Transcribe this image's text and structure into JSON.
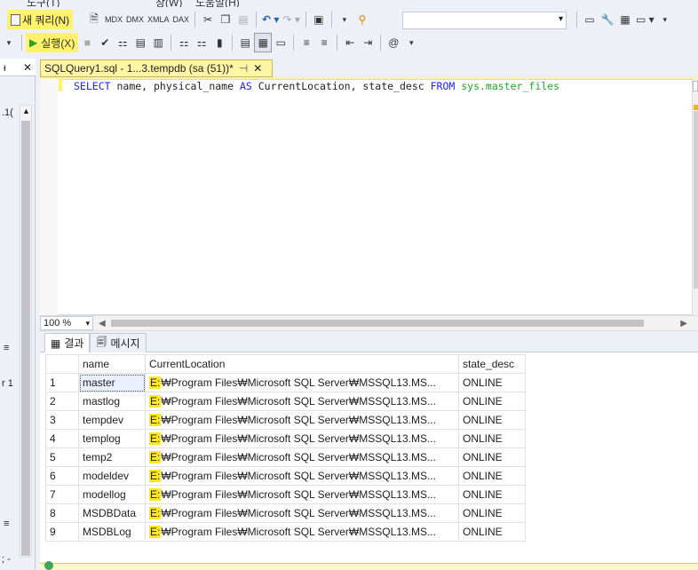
{
  "menu": [
    "도구(T)",
    "창(W)",
    "도움말(H)"
  ],
  "toolbar": {
    "new_query_label": "새 쿼리(N)",
    "execute_label": "실행(X)",
    "search_combo_value": ""
  },
  "left_pane": {
    "tab_pin": "ᵻ",
    "tab_close": "✕",
    "text_fragments": [
      ".1(",
      "≡",
      "r 1",
      "≡",
      "; -"
    ]
  },
  "document_tab": {
    "title": "SQLQuery1.sql - 1...3.tempdb (sa (51))*",
    "pin": "⊣",
    "close": "✕"
  },
  "editor": {
    "kw_select": "SELECT",
    "col1": " name, physical_name ",
    "kw_as": "AS",
    "col2": " CurrentLocation, state_desc ",
    "kw_from": "FROM",
    "table": " sys.master_files"
  },
  "zoom": {
    "value": "100 %"
  },
  "results": {
    "tab_results": "결과",
    "tab_messages": "메시지",
    "columns": [
      "name",
      "CurrentLocation",
      "state_desc"
    ],
    "rows": [
      {
        "num": "1",
        "name": "master",
        "location": "E:₩Program Files₩Microsoft SQL Server₩MSSQL13.MS...",
        "state": "ONLINE"
      },
      {
        "num": "2",
        "name": "mastlog",
        "location": "E:₩Program Files₩Microsoft SQL Server₩MSSQL13.MS...",
        "state": "ONLINE"
      },
      {
        "num": "3",
        "name": "tempdev",
        "location": "E:₩Program Files₩Microsoft SQL Server₩MSSQL13.MS...",
        "state": "ONLINE"
      },
      {
        "num": "4",
        "name": "templog",
        "location": "E:₩Program Files₩Microsoft SQL Server₩MSSQL13.MS...",
        "state": "ONLINE"
      },
      {
        "num": "5",
        "name": "temp2",
        "location": "E:₩Program Files₩Microsoft SQL Server₩MSSQL13.MS...",
        "state": "ONLINE"
      },
      {
        "num": "6",
        "name": "modeldev",
        "location": "E:₩Program Files₩Microsoft SQL Server₩MSSQL13.MS...",
        "state": "ONLINE"
      },
      {
        "num": "7",
        "name": "modellog",
        "location": "E:₩Program Files₩Microsoft SQL Server₩MSSQL13.MS...",
        "state": "ONLINE"
      },
      {
        "num": "8",
        "name": "MSDBData",
        "location": "E:₩Program Files₩Microsoft SQL Server₩MSSQL13.MS...",
        "state": "ONLINE"
      },
      {
        "num": "9",
        "name": "MSDBLog",
        "location": "E:₩Program Files₩Microsoft SQL Server₩MSSQL13.MS...",
        "state": "ONLINE"
      }
    ]
  },
  "colors": {
    "highlight": "#fff36b",
    "keyword": "#2222ff",
    "system_object": "#23a52a",
    "tab_active": "#fff5a4"
  }
}
